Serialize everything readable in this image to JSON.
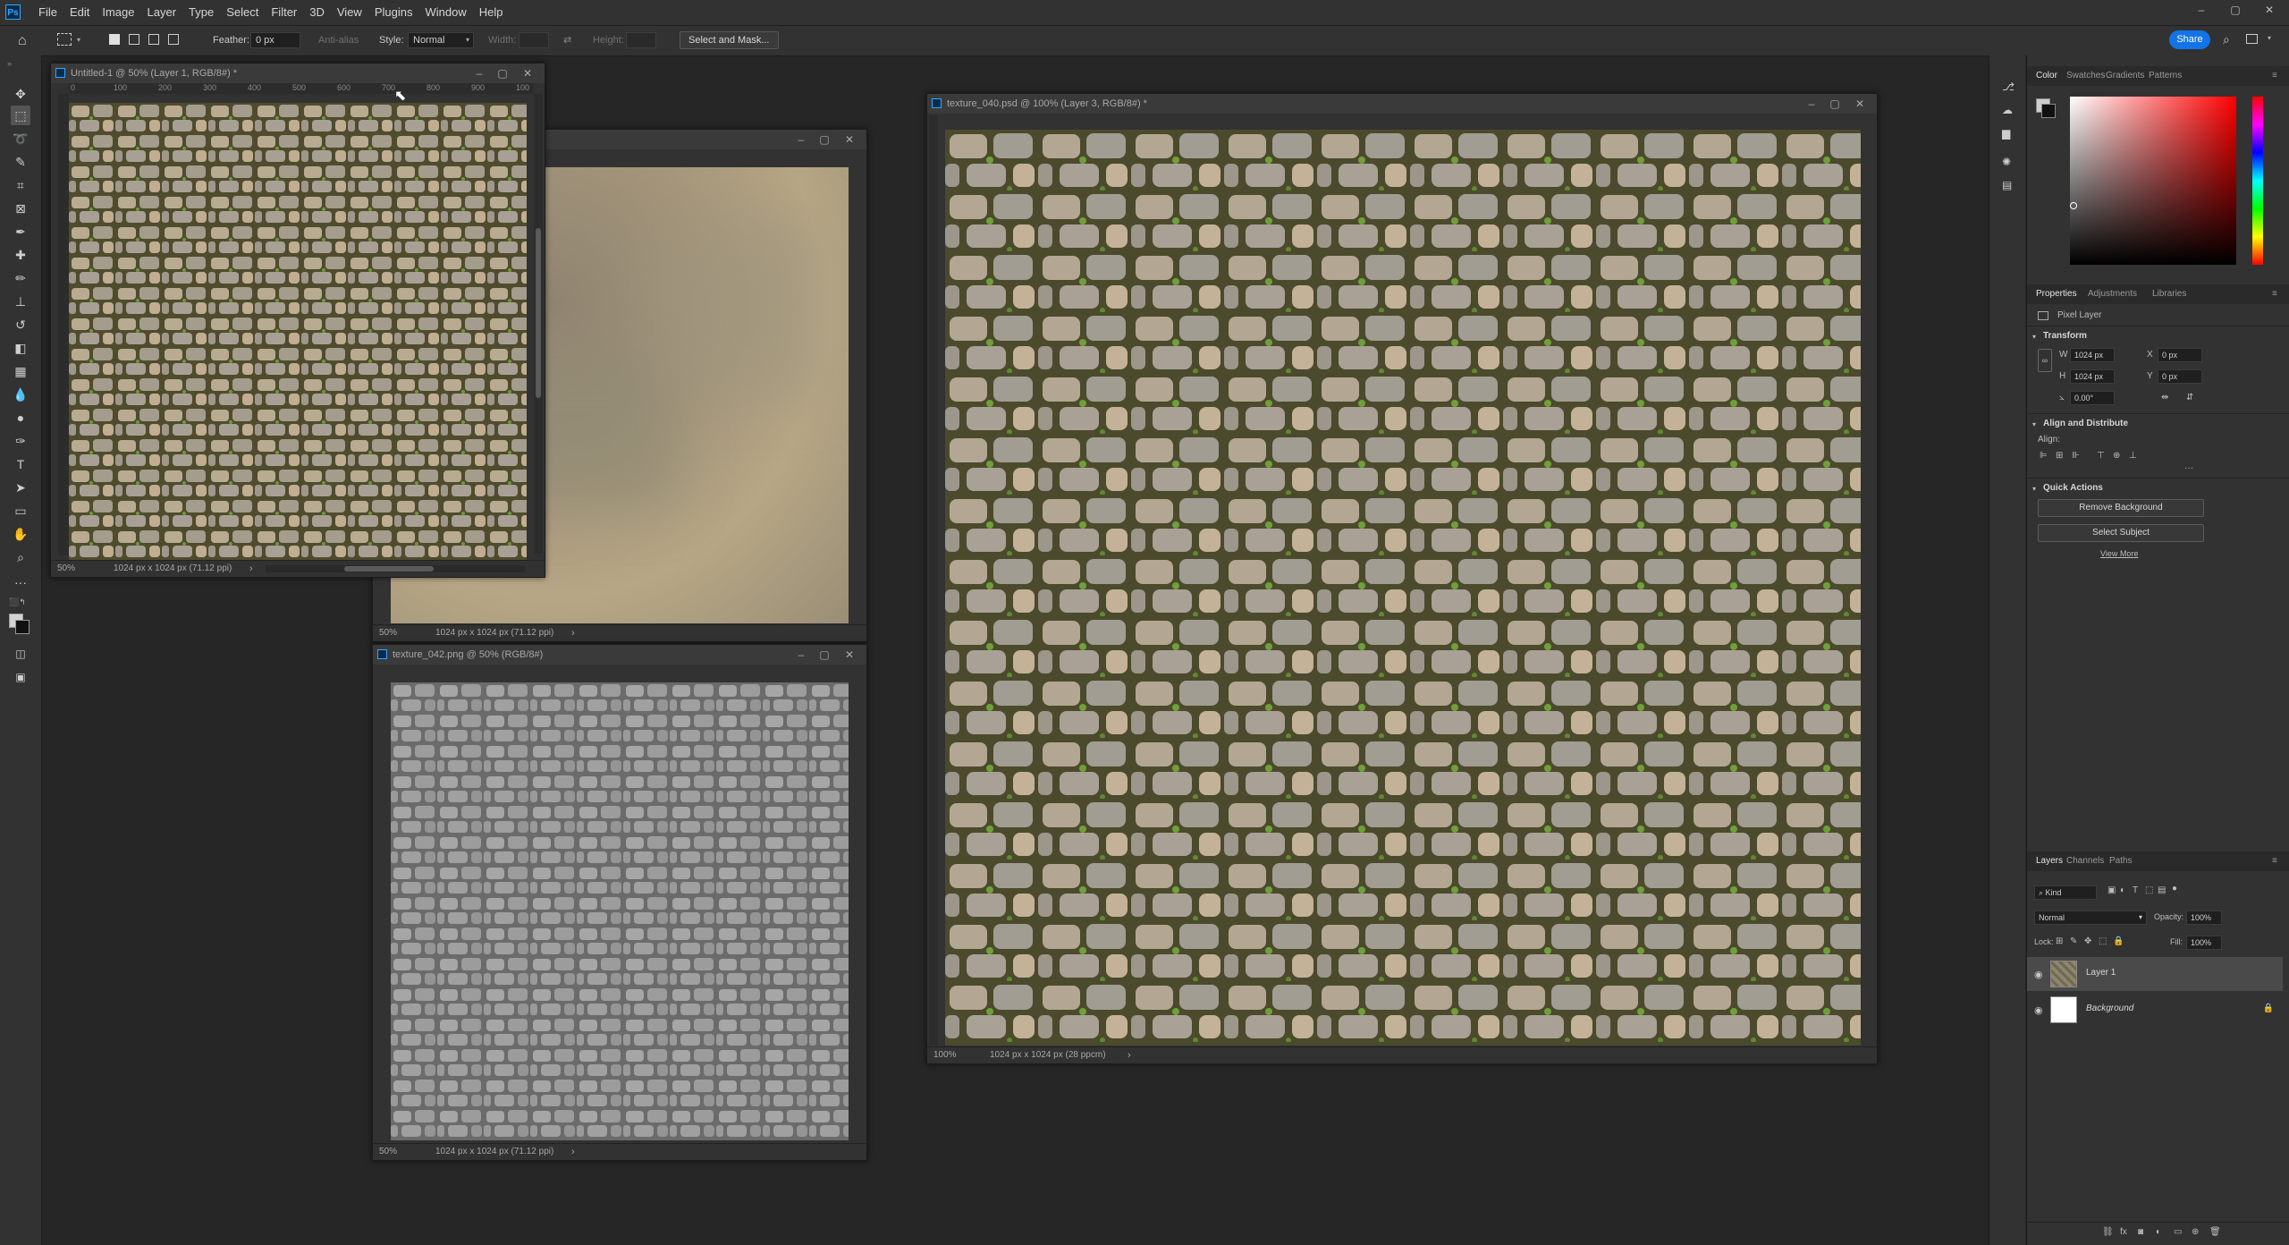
{
  "menubar": {
    "items": [
      "File",
      "Edit",
      "Image",
      "Layer",
      "Type",
      "Select",
      "Filter",
      "3D",
      "View",
      "Plugins",
      "Window",
      "Help"
    ],
    "window_controls": [
      "–",
      "▢",
      "✕"
    ]
  },
  "options": {
    "feather_label": "Feather:",
    "feather_value": "0 px",
    "antialias_label": "Anti-alias",
    "style_label": "Style:",
    "style_value": "Normal",
    "width_label": "Width:",
    "height_label": "Height:",
    "select_mask_label": "Select and Mask...",
    "share_label": "Share"
  },
  "documents": {
    "untitled": {
      "title": "Untitled-1 @ 50% (Layer 1, RGB/8#) *",
      "zoom": "50%",
      "size": "1024 px x 1024 px (71.12 ppi)",
      "ruler_ticks": [
        "0",
        "100",
        "200",
        "300",
        "400",
        "500",
        "600",
        "700",
        "800",
        "900",
        "100"
      ]
    },
    "blurred": {
      "title": "",
      "zoom": "50%",
      "size": "1024 px x 1024 px (71.12 ppi)"
    },
    "texture042": {
      "title": "texture_042.png @ 50% (RGB/8#)",
      "zoom": "50%",
      "size": "1024 px x 1024 px (71.12 ppi)"
    },
    "texture040": {
      "title": "texture_040.psd @ 100% (Layer 3, RGB/8#) *",
      "zoom": "100%",
      "size": "1024 px x 1024 px (28 ppcm)"
    }
  },
  "color_panel": {
    "tabs": [
      "Color",
      "Swatches",
      "Gradients",
      "Patterns"
    ],
    "active": "Color",
    "hue_color": "#ff0000"
  },
  "properties_panel": {
    "tabs": [
      "Properties",
      "Adjustments",
      "Libraries"
    ],
    "active": "Properties",
    "layer_type": "Pixel Layer",
    "transform_label": "Transform",
    "w_label": "W",
    "w_value": "1024 px",
    "h_label": "H",
    "h_value": "1024 px",
    "x_label": "X",
    "x_value": "0 px",
    "y_label": "Y",
    "y_value": "0 px",
    "angle_value": "0.00°",
    "align_section": "Align and Distribute",
    "align_label": "Align:",
    "quick_actions": "Quick Actions",
    "remove_bg": "Remove Background",
    "select_subject": "Select Subject",
    "view_more": "View More"
  },
  "layers_panel": {
    "tabs": [
      "Layers",
      "Channels",
      "Paths"
    ],
    "active": "Layers",
    "kind_label": "Kind",
    "blend_mode": "Normal",
    "opacity_label": "Opacity:",
    "opacity_value": "100%",
    "lock_label": "Lock:",
    "fill_label": "Fill:",
    "fill_value": "100%",
    "layers": [
      {
        "name": "Layer 1",
        "selected": true
      },
      {
        "name": "Background",
        "selected": false,
        "locked": true
      }
    ]
  }
}
